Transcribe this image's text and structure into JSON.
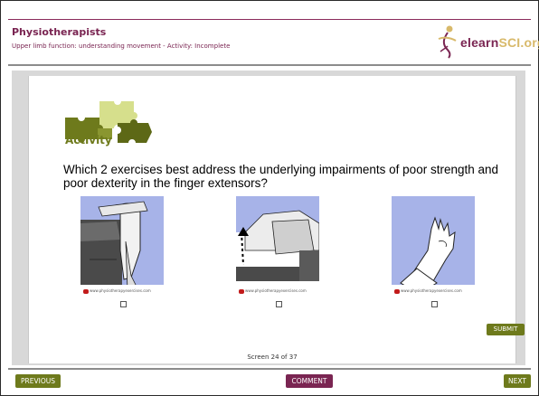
{
  "header": {
    "title": "Physiotherapists",
    "subtitle": "Upper limb function: understanding movement - Activity: Incomplete",
    "logo_main": "elearn",
    "logo_accent": "SCI.org"
  },
  "activity": {
    "label": "Activity",
    "question": "Which 2 exercises best address the underlying impairments of poor strength and poor dexterity in the finger extensors?"
  },
  "images": [
    {
      "caption": "www.physiotherapyexercises.com",
      "icon": "exercise-image-chair"
    },
    {
      "caption": "www.physiotherapyexercises.com",
      "icon": "exercise-image-towel"
    },
    {
      "caption": "www.physiotherapyexercises.com",
      "icon": "exercise-image-hand"
    }
  ],
  "buttons": {
    "submit": "SUBMIT",
    "previous": "PREVIOUS",
    "comment": "COMMENT",
    "next": "NEXT"
  },
  "screen_counter": "Screen 24 of 37",
  "colors": {
    "brand_maroon": "#7a2552",
    "olive": "#6e7a1c",
    "image_bg": "#a7b3e8"
  }
}
